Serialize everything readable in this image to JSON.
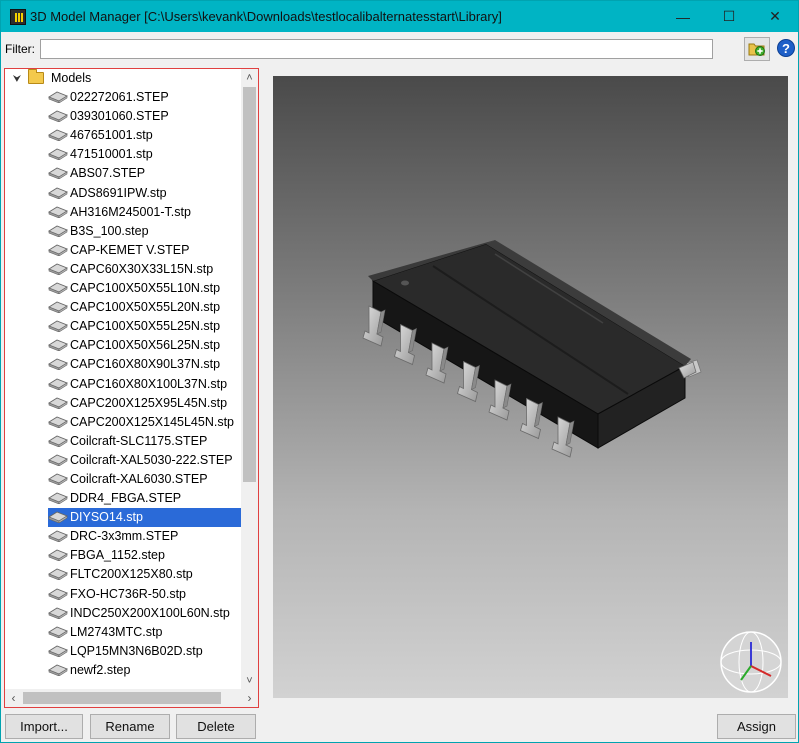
{
  "window": {
    "title": "3D Model Manager [C:\\Users\\kevank\\Downloads\\testlocalibalternatesstart\\Library]",
    "minimize_glyph": "—",
    "maximize_glyph": "☐",
    "close_glyph": "✕"
  },
  "filter": {
    "label": "Filter:",
    "value": "",
    "placeholder": ""
  },
  "toolbar": {
    "add_icon": "add-folder-icon",
    "help_label": "?"
  },
  "tree": {
    "root_label": "Models",
    "items": [
      "022272061.STEP",
      "039301060.STEP",
      "467651001.stp",
      "471510001.stp",
      "ABS07.STEP",
      "ADS8691IPW.stp",
      "AH316M245001-T.stp",
      "B3S_100.step",
      "CAP-KEMET V.STEP",
      "CAPC60X30X33L15N.stp",
      "CAPC100X50X55L10N.stp",
      "CAPC100X50X55L20N.stp",
      "CAPC100X50X55L25N.stp",
      "CAPC100X50X56L25N.stp",
      "CAPC160X80X90L37N.stp",
      "CAPC160X80X100L37N.stp",
      "CAPC200X125X95L45N.stp",
      "CAPC200X125X145L45N.stp",
      "Coilcraft-SLC1175.STEP",
      "Coilcraft-XAL5030-222.STEP",
      "Coilcraft-XAL6030.STEP",
      "DDR4_FBGA.STEP",
      "DIYSO14.stp",
      "DRC-3x3mm.STEP",
      "FBGA_1152.step",
      "FLTC200X125X80.stp",
      "FXO-HC736R-50.stp",
      "INDC250X200X100L60N.stp",
      "LM2743MTC.stp",
      "LQP15MN3N6B02D.stp",
      "newf2.step"
    ],
    "selected_index": 22
  },
  "buttons": {
    "import": "Import...",
    "rename": "Rename",
    "delete": "Delete",
    "assign": "Assign"
  },
  "colors": {
    "titlebar": "#00b4c4",
    "selection": "#2a6ad8",
    "tree_border": "#e04040"
  }
}
